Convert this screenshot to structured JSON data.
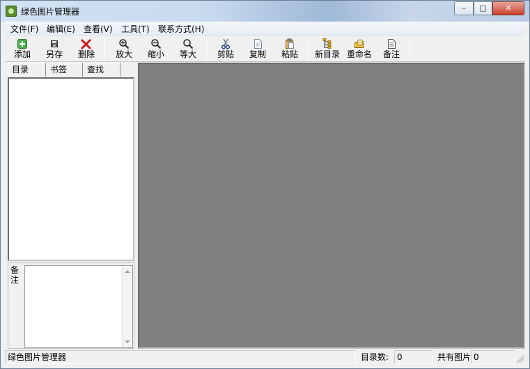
{
  "window": {
    "title": "绿色图片管理器",
    "controls": {
      "minimize": "–",
      "maximize": "□",
      "close": "✕"
    }
  },
  "menu": [
    "文件(F)",
    "编辑(E)",
    "查看(V)",
    "工具(T)",
    "联系方式(H)"
  ],
  "toolbar": [
    {
      "label": "添加",
      "icon": "add-icon"
    },
    {
      "label": "另存",
      "icon": "save-icon"
    },
    {
      "label": "删除",
      "icon": "delete-icon"
    },
    {
      "label": "放大",
      "icon": "zoom-in-icon"
    },
    {
      "label": "缩小",
      "icon": "zoom-out-icon"
    },
    {
      "label": "等大",
      "icon": "actual-size-icon"
    },
    {
      "label": "剪贴",
      "icon": "cut-icon"
    },
    {
      "label": "复制",
      "icon": "copy-icon"
    },
    {
      "label": "粘贴",
      "icon": "paste-icon"
    },
    {
      "label": "新目录",
      "icon": "new-folder-icon"
    },
    {
      "label": "重命名",
      "icon": "rename-icon"
    },
    {
      "label": "备注",
      "icon": "note-icon"
    }
  ],
  "tabs": [
    "目录",
    "书签",
    "查找"
  ],
  "note_label": "备注",
  "status": {
    "app_name": "绿色图片管理器",
    "dir_count_label": "目录数:",
    "dir_count_value": "0",
    "total_images_label": "共有图片",
    "total_images_value": "0"
  },
  "colors": {
    "viewer_background": "#808080",
    "window_background": "#f0f0f0",
    "delete_icon": "#cc1a1a"
  }
}
